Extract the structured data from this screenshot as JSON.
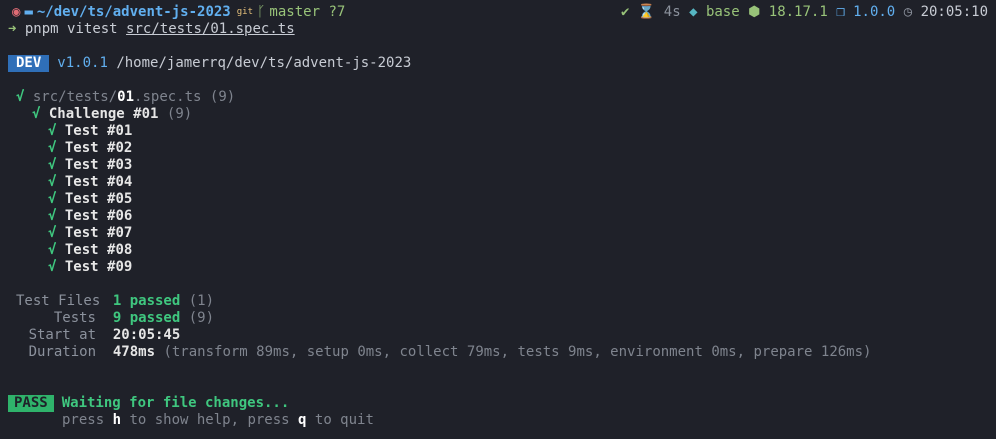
{
  "prompt": {
    "os_icon": "ubuntu-icon",
    "folder_icon": "folder-icon",
    "path": "~/dev/ts/advent-js-2023",
    "git_label": "git",
    "branch_icon": "git-branch-icon",
    "branch": "master",
    "untracked": "?7",
    "status_icon": "checkmark-icon",
    "status_glyph": "✔",
    "timer_icon": "hourglass-icon",
    "timer_glyph": "⌛",
    "duration": "4s",
    "conda_icon": "python-icon",
    "conda_glyph": "◆",
    "conda_env": "base",
    "node_icon": "node-icon",
    "node_glyph": "⬢",
    "node_version": "18.17.1",
    "package_icon": "package-icon",
    "package_glyph": "❒",
    "package_version": "1.0.0",
    "clock_icon": "clock-icon",
    "clock_glyph": "◷",
    "time": "20:05:10",
    "ubuntu_glyph": "◉",
    "folder_glyph": "▬",
    "branch_glyph": "ᚴ"
  },
  "command": {
    "arrow": "➜",
    "tool": "pnpm",
    "cmd": "vitest",
    "arg": "src/tests/01.spec.ts"
  },
  "dev_line": {
    "badge": "DEV",
    "version": "v1.0.1",
    "path": "/home/jamerrq/dev/ts/advent-js-2023"
  },
  "suite": {
    "check": "√",
    "file_prefix": "src/tests/",
    "file_bold": "01",
    "file_suffix": ".spec.ts",
    "file_count": "(9)",
    "describe": "Challenge #01",
    "describe_count": "(9)",
    "tests": [
      "Test #01",
      "Test #02",
      "Test #03",
      "Test #04",
      "Test #05",
      "Test #06",
      "Test #07",
      "Test #08",
      "Test #09"
    ]
  },
  "summary": {
    "files_label": "Test Files",
    "files_passed": "1 passed",
    "files_total": "(1)",
    "tests_label": "Tests",
    "tests_passed": "9 passed",
    "tests_total": "(9)",
    "start_label": "Start at",
    "start_time": "20:05:45",
    "duration_label": "Duration",
    "duration_value": "478ms",
    "duration_detail": "(transform 89ms, setup 0ms, collect 79ms, tests 9ms, environment 0ms, prepare 126ms)"
  },
  "watch": {
    "badge": "PASS",
    "message": "Waiting for file changes...",
    "help_1": "press ",
    "help_key_h": "h",
    "help_2": " to show help, press ",
    "help_key_q": "q",
    "help_3": " to quit"
  }
}
